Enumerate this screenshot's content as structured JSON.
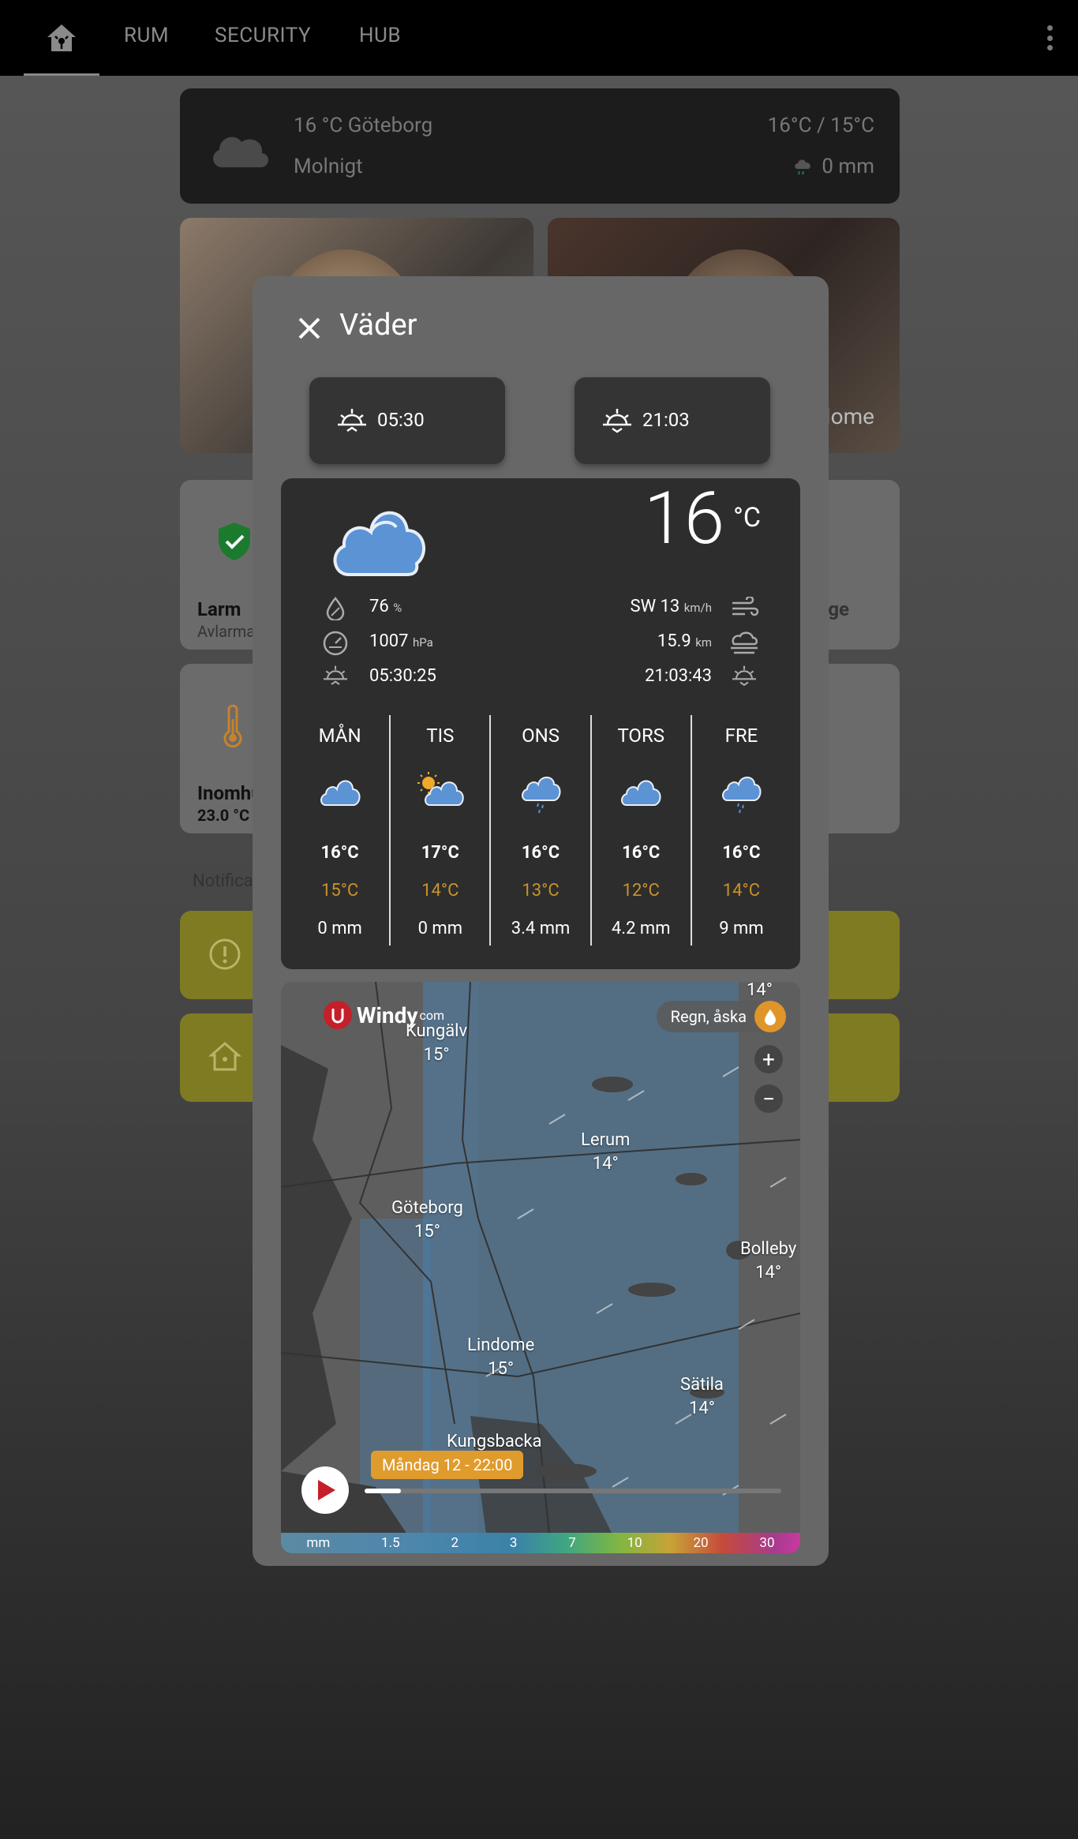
{
  "tabs": [
    "RUM",
    "SECURITY",
    "HUB"
  ],
  "weather_card": {
    "title": "16 °C Göteborg",
    "condition": "Molnigt",
    "temps": "16°C / 15°C",
    "precip": "0 mm"
  },
  "camera2_label": "Home",
  "tiles": {
    "alarm_name": "Larm",
    "alarm_state": "Avlarmat",
    "temp_name": "Inomhus",
    "temp_state": "23.0 °C",
    "tile2_label": "Läge"
  },
  "notifications_label": "Notifications",
  "dialog": {
    "title": "Väder",
    "sunrise_btn": "05:30",
    "sunset_btn": "21:03",
    "current": {
      "temp": "16",
      "unit": "°C",
      "humidity": "76",
      "humidity_unit": "%",
      "pressure": "1007",
      "pressure_unit": "hPa",
      "sunrise": "05:30:25",
      "wind": "SW 13",
      "wind_unit": "km/h",
      "visibility": "15.9",
      "visibility_unit": "km",
      "sunset": "21:03:43"
    },
    "days": [
      {
        "name": "MÅN",
        "hi": "16°C",
        "lo": "15°C",
        "precip": "0 mm",
        "icon": "cloudy-icon"
      },
      {
        "name": "TIS",
        "hi": "17°C",
        "lo": "14°C",
        "precip": "0 mm",
        "icon": "partly-sunny-icon"
      },
      {
        "name": "ONS",
        "hi": "16°C",
        "lo": "13°C",
        "precip": "3.4 mm",
        "icon": "rain-icon"
      },
      {
        "name": "TORS",
        "hi": "16°C",
        "lo": "12°C",
        "precip": "4.2 mm",
        "icon": "cloudy-icon"
      },
      {
        "name": "FRE",
        "hi": "16°C",
        "lo": "14°C",
        "precip": "9 mm",
        "icon": "rain-icon"
      }
    ],
    "map": {
      "brand": "Windy",
      "brand_suffix": "com",
      "layer": "Regn, åska",
      "time": "Måndag 12 - 22:00",
      "cities": [
        {
          "name": "Kungälv",
          "temp": "15°"
        },
        {
          "name": "",
          "temp": "14°"
        },
        {
          "name": "Lerum",
          "temp": "14°"
        },
        {
          "name": "Göteborg",
          "temp": "15°"
        },
        {
          "name": "Bolleby",
          "temp": "14°"
        },
        {
          "name": "Lindome",
          "temp": "15°"
        },
        {
          "name": "Sätila",
          "temp": "14°"
        },
        {
          "name": "Kungsbacka",
          "temp": ""
        }
      ],
      "scale": [
        "mm",
        "1.5",
        "2",
        "3",
        "7",
        "10",
        "20",
        "30"
      ]
    }
  },
  "colors": {
    "accent_orange": "#c8932a",
    "cloud_blue": "#5b93d4",
    "notif_yellow": "#7e7b22",
    "windy_red": "#c51f2a"
  }
}
